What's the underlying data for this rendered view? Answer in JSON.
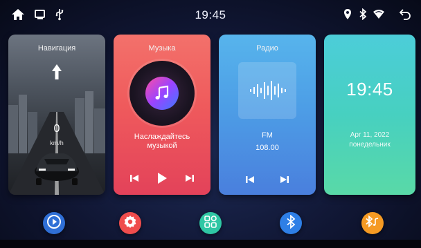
{
  "statusbar": {
    "time": "19:45",
    "left_icons": [
      "home-icon",
      "recent-apps-icon",
      "usb-icon"
    ],
    "right_icons": [
      "location-pin-icon",
      "bluetooth-icon",
      "wifi-icon",
      "back-icon"
    ]
  },
  "cards": {
    "navigation": {
      "title": "Навигация",
      "speed": "0",
      "speed_unit": "km/h"
    },
    "music": {
      "title": "Музыка",
      "text_line1": "Наслаждайтесь",
      "text_line2": "музыкой",
      "controls": [
        "previous-icon",
        "play-icon",
        "next-icon"
      ]
    },
    "radio": {
      "title": "Радио",
      "band": "FM",
      "frequency": "108.00",
      "controls": [
        "previous-icon",
        "next-icon"
      ]
    },
    "clock": {
      "time": "19:45",
      "date": "Apr 11, 2022",
      "weekday": "понедельник"
    }
  },
  "dock": [
    {
      "icon": "video-play-icon",
      "color": "#2f6fd6"
    },
    {
      "icon": "settings-gear-icon",
      "color": "#ef4d4d"
    },
    {
      "icon": "apps-grid-icon",
      "color": "#2fc7a4"
    },
    {
      "icon": "bluetooth-icon",
      "color": "#2e7fe6"
    },
    {
      "icon": "bluetooth-music-icon",
      "color": "#f59a23"
    }
  ],
  "colors": {
    "music_card": "#ef5a5c",
    "radio_card": "#4d9ee6",
    "clock_card": "#47d0c0",
    "background": "#101633"
  }
}
